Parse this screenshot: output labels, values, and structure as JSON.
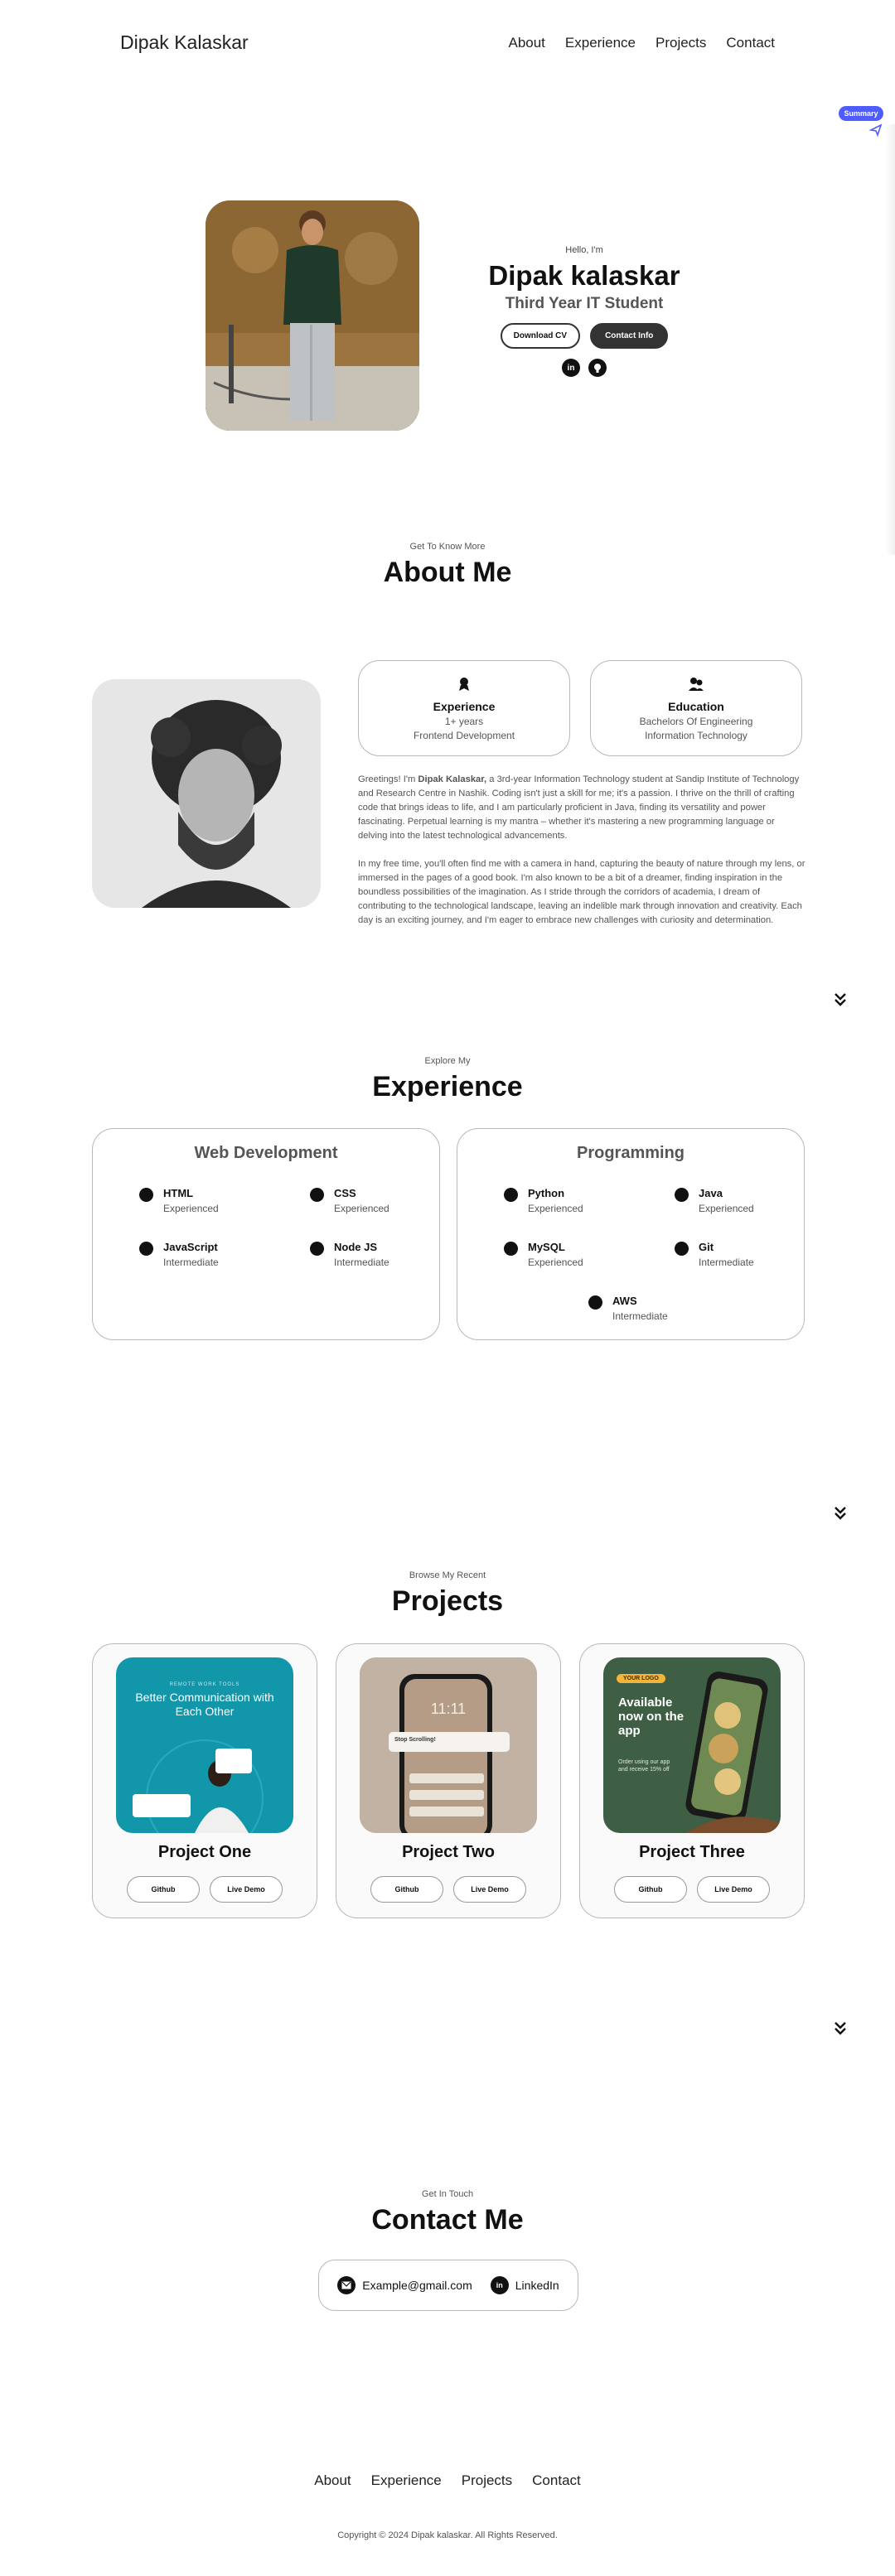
{
  "nav": {
    "logo": "Dipak Kalaskar",
    "links": [
      "About",
      "Experience",
      "Projects",
      "Contact"
    ]
  },
  "summary_badge": "Summary",
  "hero": {
    "greeting": "Hello, I'm",
    "name": "Dipak kalaskar",
    "role": "Third Year IT Student",
    "download_cv": "Download CV",
    "contact_info": "Contact Info",
    "socials": [
      "linkedin-icon",
      "github-icon"
    ]
  },
  "about": {
    "kicker": "Get To Know More",
    "title": "About Me",
    "experience_card": {
      "title": "Experience",
      "lines": [
        "1+ years",
        "Frontend Development"
      ]
    },
    "education_card": {
      "title": "Education",
      "lines": [
        "Bachelors Of Engineering",
        "Information Technology"
      ]
    },
    "para1_prefix": "Greetings! I'm ",
    "para1_name": "Dipak Kalaskar,",
    "para1_rest": " a 3rd-year Information Technology student at Sandip Institute of Technology and Research Centre in Nashik. Coding isn't just a skill for me; it's a passion. I thrive on the thrill of crafting code that brings ideas to life, and I am particularly proficient in Java, finding its versatility and power fascinating. Perpetual learning is my mantra – whether it's mastering a new programming language or delving into the latest technological advancements.",
    "para2": "In my free time, you'll often find me with a camera in hand, capturing the beauty of nature through my lens, or immersed in the pages of a good book. I'm also known to be a bit of a dreamer, finding inspiration in the boundless possibilities of the imagination. As I stride through the corridors of academia, I dream of contributing to the technological landscape, leaving an indelible mark through innovation and creativity. Each day is an exciting journey, and I'm eager to embrace new challenges with curiosity and determination."
  },
  "experience": {
    "kicker": "Explore My",
    "title": "Experience",
    "web": {
      "title": "Web Development",
      "skills": [
        {
          "name": "HTML",
          "level": "Experienced"
        },
        {
          "name": "CSS",
          "level": "Experienced"
        },
        {
          "name": "JavaScript",
          "level": "Intermediate"
        },
        {
          "name": "Node JS",
          "level": "Intermediate"
        }
      ]
    },
    "programming": {
      "title": "Programming",
      "skills": [
        {
          "name": "Python",
          "level": "Experienced"
        },
        {
          "name": "Java",
          "level": "Experienced"
        },
        {
          "name": "MySQL",
          "level": "Experienced"
        },
        {
          "name": "Git",
          "level": "Intermediate"
        },
        {
          "name": "AWS",
          "level": "Intermediate"
        }
      ]
    }
  },
  "projects": {
    "kicker": "Browse My Recent",
    "title": "Projects",
    "items": [
      {
        "title": "Project One",
        "github": "Github",
        "demo": "Live Demo",
        "img_kicker": "REMOTE WORK TOOLS",
        "img_text": "Better Communication with Each Other"
      },
      {
        "title": "Project Two",
        "github": "Github",
        "demo": "Live Demo",
        "img_time": "11:11",
        "img_text": "Stop Scrolling!"
      },
      {
        "title": "Project Three",
        "github": "Github",
        "demo": "Live Demo",
        "img_logo": "YOUR LOGO",
        "img_text": "Available now on the app",
        "img_sub": "Order using our app and receive 15% off"
      }
    ]
  },
  "contact": {
    "kicker": "Get In Touch",
    "title": "Contact Me",
    "email": "Example@gmail.com",
    "linkedin": "LinkedIn"
  },
  "footer": {
    "links": [
      "About",
      "Experience",
      "Projects",
      "Contact"
    ],
    "copyright": "Copyright © 2024 Dipak kalaskar. All Rights Reserved."
  },
  "colors": {
    "accent": "#4f5dff",
    "dark": "#333333",
    "border": "#b8b8b8",
    "project_one_bg": "#1196aa",
    "project_three_bg": "#3e5f43"
  }
}
